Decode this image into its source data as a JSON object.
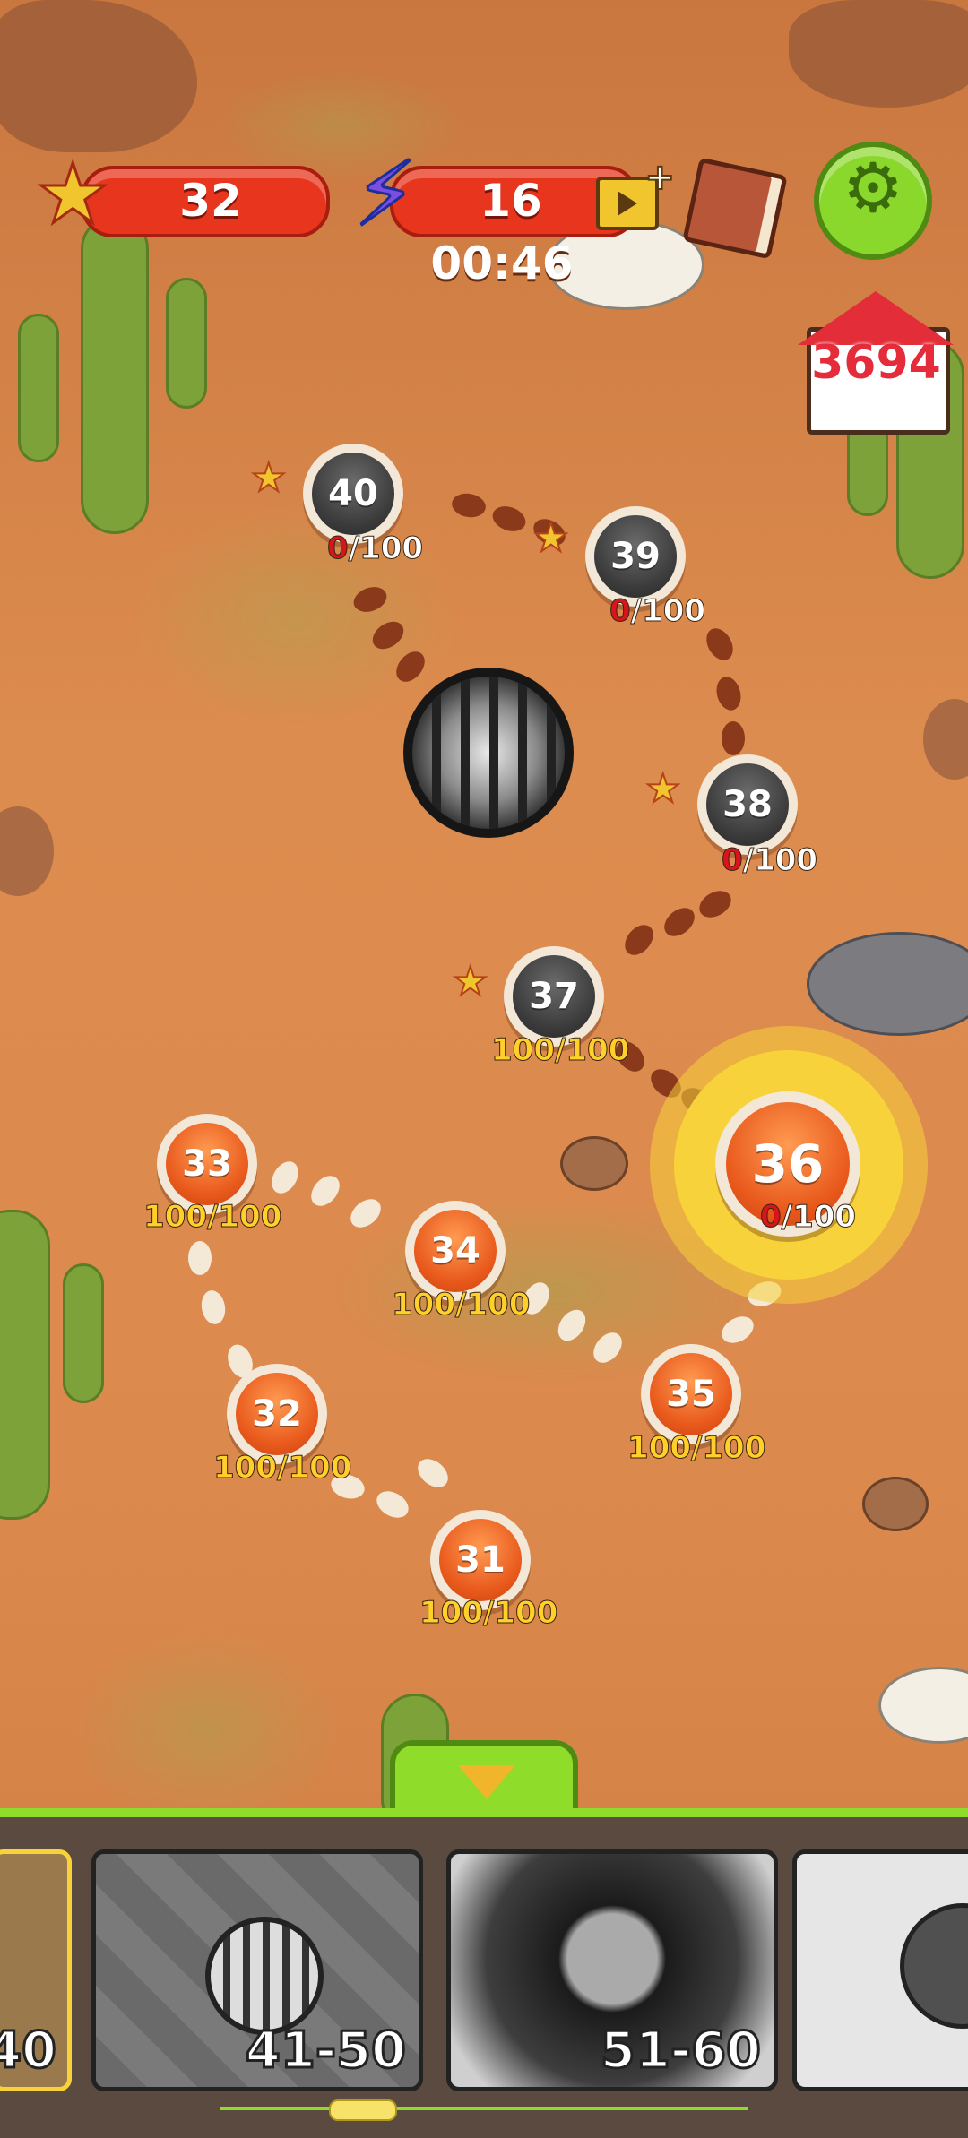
{
  "hud": {
    "stars": "32",
    "energy": "16",
    "timer": "00:46",
    "coins": "3694"
  },
  "icons": {
    "star": "star-icon",
    "energy": "lightning-icon",
    "video": "video-ad-plus-icon",
    "book": "book-icon",
    "settings": "gear-icon",
    "home": "house-icon",
    "locked_level": "caged-orb-icon",
    "collapse": "chevron-down-icon"
  },
  "levels": [
    {
      "number": "31",
      "score_done": "100/100"
    },
    {
      "number": "32",
      "score_done": "100/100"
    },
    {
      "number": "33",
      "score_done": "100/100"
    },
    {
      "number": "34",
      "score_done": "100/100"
    },
    {
      "number": "35",
      "score_done": "100/100"
    },
    {
      "number": "36",
      "score_zero": "0",
      "score_rest": "/100"
    },
    {
      "number": "37",
      "score_done": "100/100"
    },
    {
      "number": "38",
      "score_zero": "0",
      "score_rest": "/100"
    },
    {
      "number": "39",
      "score_zero": "0",
      "score_rest": "/100"
    },
    {
      "number": "40",
      "score_zero": "0",
      "score_rest": "/100"
    }
  ],
  "chapters": [
    {
      "label": "40"
    },
    {
      "label": "41-50"
    },
    {
      "label": "51-60"
    }
  ],
  "colors": {
    "accent_green": "#8fdc2b",
    "hud_red": "#e8361e",
    "completed_score": "#ffd02a",
    "zero_score": "#d8141d",
    "current_ring": "#f7d23a"
  }
}
